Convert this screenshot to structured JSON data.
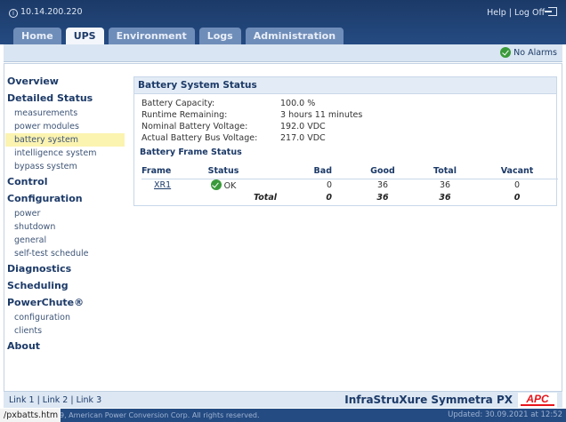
{
  "header": {
    "ip": "10.14.200.220",
    "help": "Help",
    "separator": "|",
    "logoff": "Log Off"
  },
  "tabs": [
    {
      "label": "Home",
      "active": false
    },
    {
      "label": "UPS",
      "active": true
    },
    {
      "label": "Environment",
      "active": false
    },
    {
      "label": "Logs",
      "active": false
    },
    {
      "label": "Administration",
      "active": false
    }
  ],
  "alarm_status": "No Alarms",
  "sidebar": {
    "overview": "Overview",
    "detailed_status": "Detailed Status",
    "measurements": "measurements",
    "power_modules": "power modules",
    "battery_system": "battery system",
    "intelligence_system": "intelligence system",
    "bypass_system": "bypass system",
    "control": "Control",
    "configuration": "Configuration",
    "power": "power",
    "shutdown": "shutdown",
    "general": "general",
    "self_test_schedule": "self-test schedule",
    "diagnostics": "Diagnostics",
    "scheduling": "Scheduling",
    "powerchute": "PowerChute®",
    "pc_configuration": "configuration",
    "pc_clients": "clients",
    "about": "About"
  },
  "battery_status": {
    "title": "Battery System Status",
    "capacity_label": "Battery Capacity:",
    "capacity_value": "100.0 %",
    "runtime_label": "Runtime Remaining:",
    "runtime_value": "3 hours 11 minutes",
    "nominal_label": "Nominal Battery Voltage:",
    "nominal_value": "192.0 VDC",
    "actual_label": "Actual Battery Bus Voltage:",
    "actual_value": "217.0 VDC",
    "frame_title": "Battery Frame Status"
  },
  "frame_table": {
    "headers": {
      "frame": "Frame",
      "status": "Status",
      "bad": "Bad",
      "good": "Good",
      "total": "Total",
      "vacant": "Vacant"
    },
    "row": {
      "frame": "XR1",
      "status": "OK",
      "bad": "0",
      "good": "36",
      "total": "36",
      "vacant": "0"
    },
    "totals": {
      "label": "Total",
      "bad": "0",
      "good": "36",
      "total": "36",
      "vacant": "0"
    }
  },
  "footer": {
    "link1": "Link 1",
    "link2": "Link 2",
    "link3": "Link 3",
    "separator": "|",
    "product": "InfraStruXure Symmetra PX",
    "logo": "APC"
  },
  "statusbar": {
    "url": "/pxbatts.htm",
    "copyright": "9, American Power Conversion Corp. All rights reserved.",
    "updated": "Updated: 30.09.2021 at 12:52"
  },
  "colors": {
    "accent": "#1c3a68",
    "ok": "#3a9a3a",
    "logo": "#e8141b"
  }
}
